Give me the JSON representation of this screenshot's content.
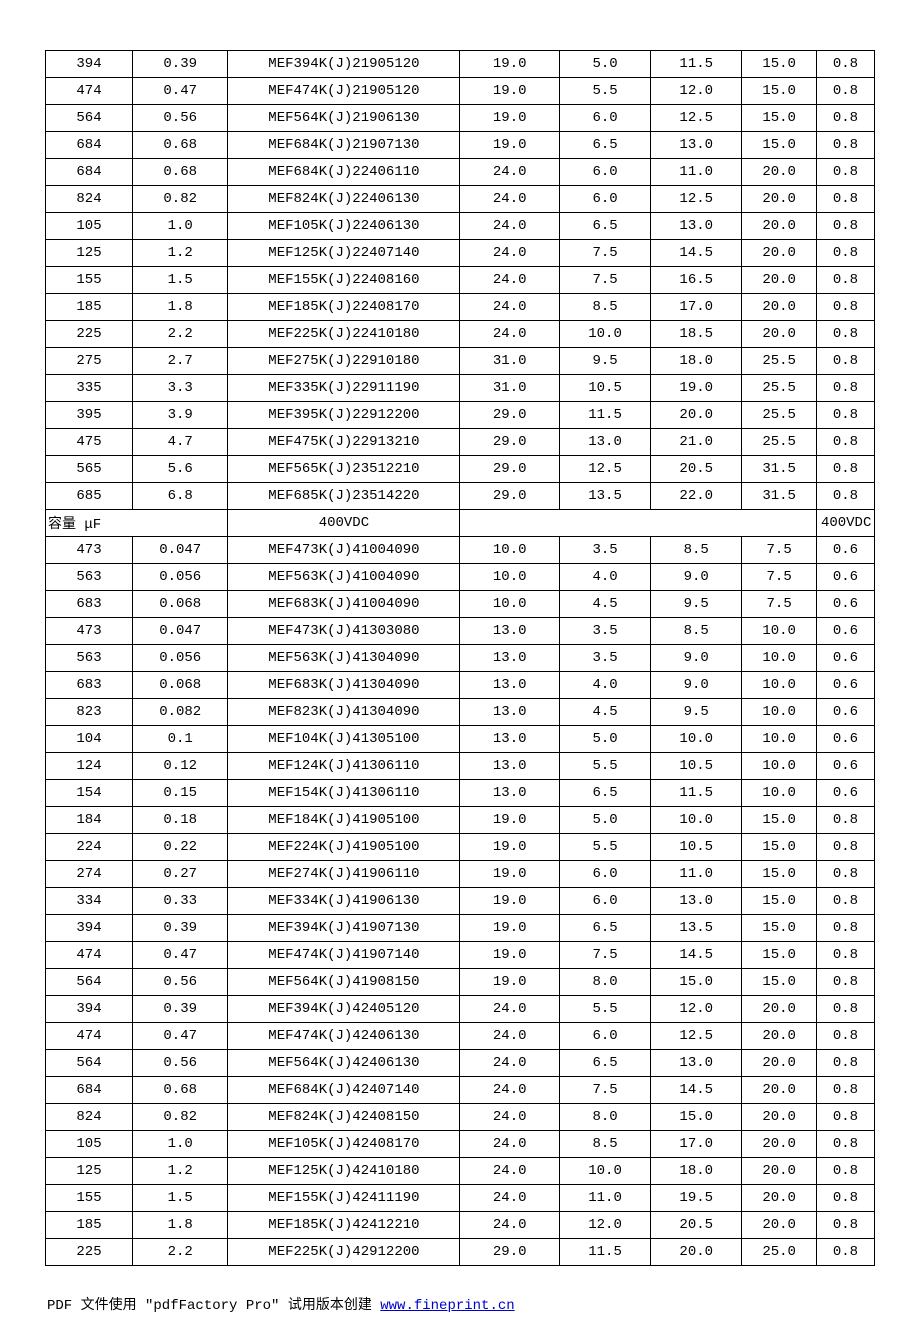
{
  "sections": [
    {
      "type": "rows",
      "rows": [
        [
          "394",
          "0.39",
          "MEF394K(J)21905120",
          "19.0",
          "5.0",
          "11.5",
          "15.0",
          "0.8"
        ],
        [
          "474",
          "0.47",
          "MEF474K(J)21905120",
          "19.0",
          "5.5",
          "12.0",
          "15.0",
          "0.8"
        ],
        [
          "564",
          "0.56",
          "MEF564K(J)21906130",
          "19.0",
          "6.0",
          "12.5",
          "15.0",
          "0.8"
        ],
        [
          "684",
          "0.68",
          "MEF684K(J)21907130",
          "19.0",
          "6.5",
          "13.0",
          "15.0",
          "0.8"
        ],
        [
          "684",
          "0.68",
          "MEF684K(J)22406110",
          "24.0",
          "6.0",
          "11.0",
          "20.0",
          "0.8"
        ],
        [
          "824",
          "0.82",
          "MEF824K(J)22406130",
          "24.0",
          "6.0",
          "12.5",
          "20.0",
          "0.8"
        ],
        [
          "105",
          "1.0",
          "MEF105K(J)22406130",
          "24.0",
          "6.5",
          "13.0",
          "20.0",
          "0.8"
        ],
        [
          "125",
          "1.2",
          "MEF125K(J)22407140",
          "24.0",
          "7.5",
          "14.5",
          "20.0",
          "0.8"
        ],
        [
          "155",
          "1.5",
          "MEF155K(J)22408160",
          "24.0",
          "7.5",
          "16.5",
          "20.0",
          "0.8"
        ],
        [
          "185",
          "1.8",
          "MEF185K(J)22408170",
          "24.0",
          "8.5",
          "17.0",
          "20.0",
          "0.8"
        ],
        [
          "225",
          "2.2",
          "MEF225K(J)22410180",
          "24.0",
          "10.0",
          "18.5",
          "20.0",
          "0.8"
        ],
        [
          "275",
          "2.7",
          "MEF275K(J)22910180",
          "31.0",
          "9.5",
          "18.0",
          "25.5",
          "0.8"
        ],
        [
          "335",
          "3.3",
          "MEF335K(J)22911190",
          "31.0",
          "10.5",
          "19.0",
          "25.5",
          "0.8"
        ],
        [
          "395",
          "3.9",
          "MEF395K(J)22912200",
          "29.0",
          "11.5",
          "20.0",
          "25.5",
          "0.8"
        ],
        [
          "475",
          "4.7",
          "MEF475K(J)22913210",
          "29.0",
          "13.0",
          "21.0",
          "25.5",
          "0.8"
        ],
        [
          "565",
          "5.6",
          "MEF565K(J)23512210",
          "29.0",
          "12.5",
          "20.5",
          "31.5",
          "0.8"
        ],
        [
          "685",
          "6.8",
          "MEF685K(J)23514220",
          "29.0",
          "13.5",
          "22.0",
          "31.5",
          "0.8"
        ]
      ]
    },
    {
      "type": "header",
      "left": "容量 μF",
      "center": "400VDC",
      "right": "400VDC"
    },
    {
      "type": "rows",
      "rows": [
        [
          "473",
          "0.047",
          "MEF473K(J)41004090",
          "10.0",
          "3.5",
          "8.5",
          "7.5",
          "0.6"
        ],
        [
          "563",
          "0.056",
          "MEF563K(J)41004090",
          "10.0",
          "4.0",
          "9.0",
          "7.5",
          "0.6"
        ],
        [
          "683",
          "0.068",
          "MEF683K(J)41004090",
          "10.0",
          "4.5",
          "9.5",
          "7.5",
          "0.6"
        ],
        [
          "473",
          "0.047",
          "MEF473K(J)41303080",
          "13.0",
          "3.5",
          "8.5",
          "10.0",
          "0.6"
        ],
        [
          "563",
          "0.056",
          "MEF563K(J)41304090",
          "13.0",
          "3.5",
          "9.0",
          "10.0",
          "0.6"
        ],
        [
          "683",
          "0.068",
          "MEF683K(J)41304090",
          "13.0",
          "4.0",
          "9.0",
          "10.0",
          "0.6"
        ],
        [
          "823",
          "0.082",
          "MEF823K(J)41304090",
          "13.0",
          "4.5",
          "9.5",
          "10.0",
          "0.6"
        ],
        [
          "104",
          "0.1",
          "MEF104K(J)41305100",
          "13.0",
          "5.0",
          "10.0",
          "10.0",
          "0.6"
        ],
        [
          "124",
          "0.12",
          "MEF124K(J)41306110",
          "13.0",
          "5.5",
          "10.5",
          "10.0",
          "0.6"
        ],
        [
          "154",
          "0.15",
          "MEF154K(J)41306110",
          "13.0",
          "6.5",
          "11.5",
          "10.0",
          "0.6"
        ],
        [
          "184",
          "0.18",
          "MEF184K(J)41905100",
          "19.0",
          "5.0",
          "10.0",
          "15.0",
          "0.8"
        ],
        [
          "224",
          "0.22",
          "MEF224K(J)41905100",
          "19.0",
          "5.5",
          "10.5",
          "15.0",
          "0.8"
        ],
        [
          "274",
          "0.27",
          "MEF274K(J)41906110",
          "19.0",
          "6.0",
          "11.0",
          "15.0",
          "0.8"
        ],
        [
          "334",
          "0.33",
          "MEF334K(J)41906130",
          "19.0",
          "6.0",
          "13.0",
          "15.0",
          "0.8"
        ],
        [
          "394",
          "0.39",
          "MEF394K(J)41907130",
          "19.0",
          "6.5",
          "13.5",
          "15.0",
          "0.8"
        ],
        [
          "474",
          "0.47",
          "MEF474K(J)41907140",
          "19.0",
          "7.5",
          "14.5",
          "15.0",
          "0.8"
        ],
        [
          "564",
          "0.56",
          "MEF564K(J)41908150",
          "19.0",
          "8.0",
          "15.0",
          "15.0",
          "0.8"
        ],
        [
          "394",
          "0.39",
          "MEF394K(J)42405120",
          "24.0",
          "5.5",
          "12.0",
          "20.0",
          "0.8"
        ],
        [
          "474",
          "0.47",
          "MEF474K(J)42406130",
          "24.0",
          "6.0",
          "12.5",
          "20.0",
          "0.8"
        ],
        [
          "564",
          "0.56",
          "MEF564K(J)42406130",
          "24.0",
          "6.5",
          "13.0",
          "20.0",
          "0.8"
        ],
        [
          "684",
          "0.68",
          "MEF684K(J)42407140",
          "24.0",
          "7.5",
          "14.5",
          "20.0",
          "0.8"
        ],
        [
          "824",
          "0.82",
          "MEF824K(J)42408150",
          "24.0",
          "8.0",
          "15.0",
          "20.0",
          "0.8"
        ],
        [
          "105",
          "1.0",
          "MEF105K(J)42408170",
          "24.0",
          "8.5",
          "17.0",
          "20.0",
          "0.8"
        ],
        [
          "125",
          "1.2",
          "MEF125K(J)42410180",
          "24.0",
          "10.0",
          "18.0",
          "20.0",
          "0.8"
        ],
        [
          "155",
          "1.5",
          "MEF155K(J)42411190",
          "24.0",
          "11.0",
          "19.5",
          "20.0",
          "0.8"
        ],
        [
          "185",
          "1.8",
          "MEF185K(J)42412210",
          "24.0",
          "12.0",
          "20.5",
          "20.0",
          "0.8"
        ],
        [
          "225",
          "2.2",
          "MEF225K(J)42912200",
          "29.0",
          "11.5",
          "20.0",
          "25.0",
          "0.8"
        ]
      ]
    }
  ],
  "footer": {
    "prefix": "PDF 文件使用 \"pdfFactory Pro\" 试用版本创建 ",
    "link_text": "www.fineprint.cn"
  }
}
